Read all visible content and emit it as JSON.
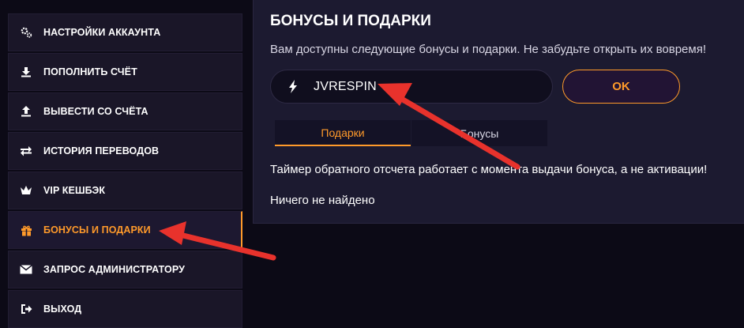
{
  "sidebar": {
    "items": [
      {
        "label": "НАСТРОЙКИ АККАУНТА",
        "icon": "gears-icon",
        "active": false
      },
      {
        "label": "ПОПОЛНИТЬ СЧЁТ",
        "icon": "download-icon",
        "active": false
      },
      {
        "label": "ВЫВЕСТИ СО СЧЁТА",
        "icon": "upload-icon",
        "active": false
      },
      {
        "label": "ИСТОРИЯ ПЕРЕВОДОВ",
        "icon": "transfer-arrows-icon",
        "active": false
      },
      {
        "label": "VIP КЕШБЭК",
        "icon": "crown-icon",
        "active": false
      },
      {
        "label": "БОНУСЫ И ПОДАРКИ",
        "icon": "gift-icon",
        "active": true
      },
      {
        "label": "ЗАПРОС АДМИНИСТРАТОРУ",
        "icon": "envelope-icon",
        "active": false
      },
      {
        "label": "ВЫХОД",
        "icon": "logout-icon",
        "active": false
      }
    ]
  },
  "panel": {
    "title": "БОНУСЫ И ПОДАРКИ",
    "description": "Вам доступны следующие бонусы и подарки. Не забудьте открыть их вовремя!",
    "promo_input": {
      "value": "JVRESPIN",
      "icon": "lightning-icon"
    },
    "ok_label": "OK",
    "tabs": [
      {
        "label": "Подарки",
        "active": true
      },
      {
        "label": "Бонусы",
        "active": false
      }
    ],
    "timer_note": "Таймер обратного отсчета работает с момента выдачи бонуса, а не активации!",
    "empty_message": "Ничего не найдено"
  },
  "colors": {
    "accent": "#ff9a2a",
    "background": "#0c0a16",
    "panel": "#1c1a30",
    "arrow": "#e8322c"
  }
}
